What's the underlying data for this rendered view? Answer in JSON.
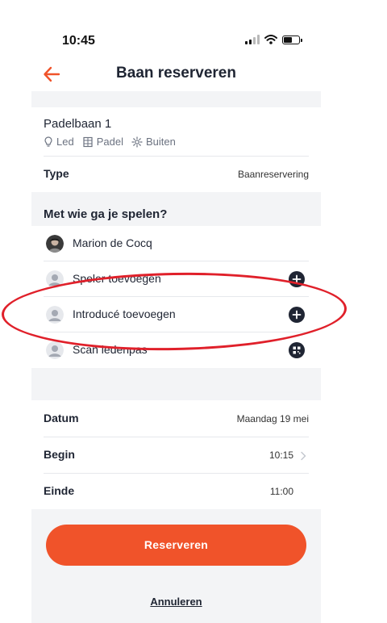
{
  "status_bar": {
    "time": "10:45"
  },
  "header": {
    "title": "Baan reserveren"
  },
  "court": {
    "name": "Padelbaan 1",
    "features": [
      {
        "icon": "lightbulb-icon",
        "label": "Led"
      },
      {
        "icon": "building-icon",
        "label": "Padel"
      },
      {
        "icon": "gear-icon",
        "label": "Buiten"
      }
    ]
  },
  "type_row": {
    "label": "Type",
    "value": "Baanreservering"
  },
  "players": {
    "title": "Met wie ga je spelen?",
    "items": [
      {
        "name": "Marion de Cocq",
        "action": ""
      },
      {
        "name": "Speler toevoegen",
        "action": "plus-icon"
      },
      {
        "name": "Introducé toevoegen",
        "action": "plus-icon"
      },
      {
        "name": "Scan ledenpas",
        "action": "qr-icon"
      }
    ]
  },
  "details": {
    "date": {
      "label": "Datum",
      "value": "Maandag 19 mei"
    },
    "start": {
      "label": "Begin",
      "value": "10:15"
    },
    "end": {
      "label": "Einde",
      "value": "11:00"
    }
  },
  "actions": {
    "reserve": "Reserveren",
    "cancel": "Annuleren"
  },
  "colors": {
    "accent": "#f0532a",
    "dark": "#1f2533",
    "annotation": "#e0202a",
    "band": "#f3f4f6"
  }
}
